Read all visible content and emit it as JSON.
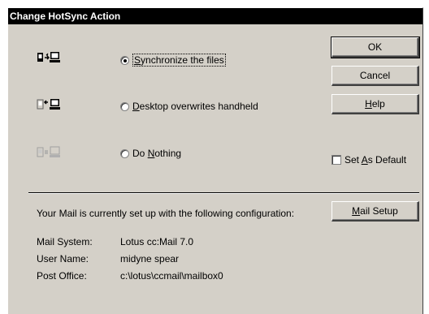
{
  "window": {
    "title": "Change HotSync Action"
  },
  "buttons": {
    "ok": "OK",
    "cancel": "Cancel",
    "help_pre": "",
    "help_key": "H",
    "help_post": "elp",
    "mail_setup_pre": "",
    "mail_setup_key": "M",
    "mail_setup_post": "ail Setup"
  },
  "options": [
    {
      "pre": "",
      "key": "S",
      "post": "ynchronize the files",
      "checked": true,
      "icon": "handheld-sync-desktop-icon"
    },
    {
      "pre": "",
      "key": "D",
      "post": "esktop overwrites handheld",
      "checked": false,
      "icon": "desktop-to-handheld-icon"
    },
    {
      "pre": "Do ",
      "key": "N",
      "post": "othing",
      "checked": false,
      "icon": "no-transfer-icon"
    }
  ],
  "set_default": {
    "pre": "Set ",
    "key": "A",
    "post": "s Default",
    "checked": false
  },
  "config": {
    "intro": "Your Mail is currently set up with the following configuration:",
    "rows": [
      {
        "label": "Mail System:",
        "value": "Lotus cc:Mail 7.0"
      },
      {
        "label": "User Name:",
        "value": "midyne spear"
      },
      {
        "label": "Post Office:",
        "value": "c:\\lotus\\ccmail\\mailbox0"
      }
    ]
  },
  "colors": {
    "titlebar": "#000000",
    "face": "#d4d0c8",
    "disabled_icon": "#a0a0a0"
  }
}
